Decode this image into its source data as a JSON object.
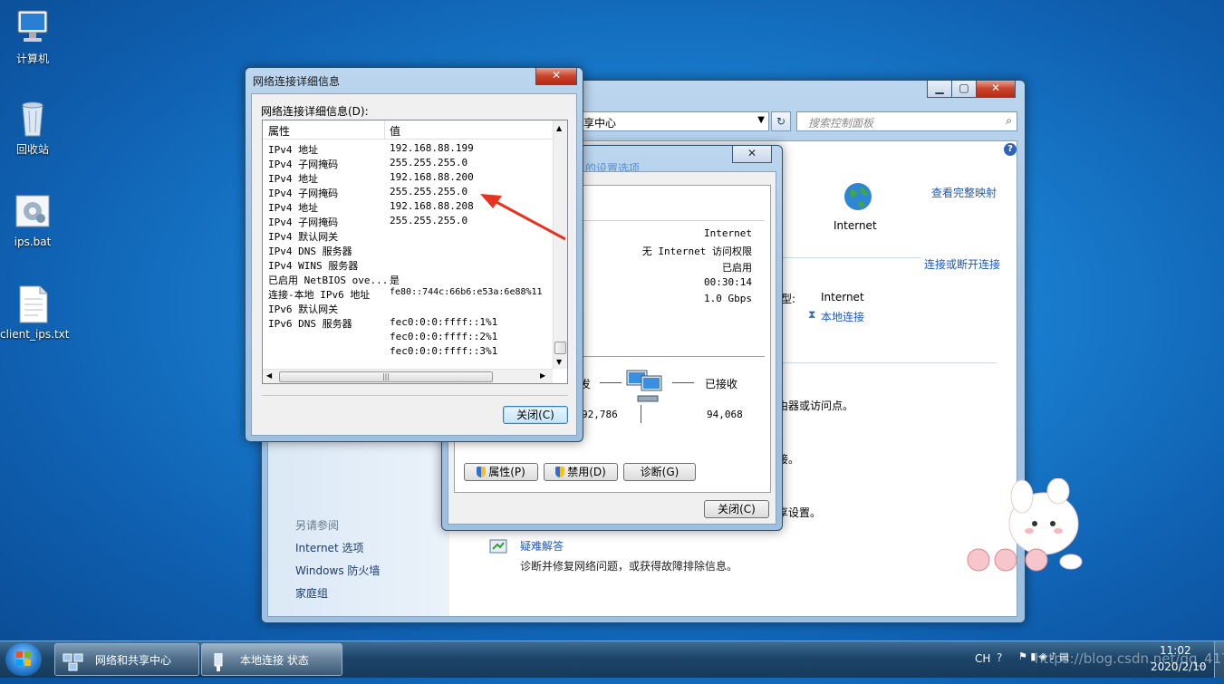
{
  "desktop": {
    "icons": [
      {
        "label": "计算机",
        "icon": "computer-icon"
      },
      {
        "label": "回收站",
        "icon": "recycle-bin-icon"
      },
      {
        "label": "ips.bat",
        "icon": "batch-file-icon"
      },
      {
        "label": "client_ips.txt",
        "icon": "text-file-icon"
      }
    ]
  },
  "control_panel": {
    "breadcrumb": "享中心",
    "search_placeholder": "搜索控制面板",
    "view_full_map": "查看完整映射",
    "internet_label": "Internet",
    "connect_disconnect": "连接或断开连接",
    "type_label": "型:",
    "type_value": "Internet",
    "local_connection": "本地连接",
    "router_text": "由器或访问点。",
    "task_text_1": "接。",
    "share_text": "享设置。",
    "see_also": "另请参阅",
    "sidebar_links": [
      "Internet 选项",
      "Windows 防火墙",
      "家庭组"
    ],
    "troubleshoot_title": "疑难解答",
    "troubleshoot_desc": "诊断并修复网络问题，或获得故障排除信息。"
  },
  "status_dialog": {
    "link_partial": "的设置选项",
    "ipv4_connectivity": "Internet",
    "ipv6_connectivity": "无 Internet 访问权限",
    "media_state": "已启用",
    "duration": "00:30:14",
    "speed": "1.0 Gbps",
    "sent_label": "发",
    "received_label": "已接收",
    "bytes_sent": "92,786",
    "bytes_received": "94,068",
    "properties_button": "属性(P)",
    "disable_button": "禁用(D)",
    "diagnose_button": "诊断(G)",
    "close_button": "关闭(C)"
  },
  "details_dialog": {
    "title": "网络连接详细信息",
    "group_label": "网络连接详细信息(D):",
    "col_property": "属性",
    "col_value": "值",
    "rows": [
      {
        "property": "IPv4 地址",
        "value": "192.168.88.199"
      },
      {
        "property": "IPv4 子网掩码",
        "value": "255.255.255.0"
      },
      {
        "property": "IPv4 地址",
        "value": "192.168.88.200"
      },
      {
        "property": "IPv4 子网掩码",
        "value": "255.255.255.0"
      },
      {
        "property": "IPv4 地址",
        "value": "192.168.88.208"
      },
      {
        "property": "IPv4 子网掩码",
        "value": "255.255.255.0"
      },
      {
        "property": "IPv4 默认网关",
        "value": ""
      },
      {
        "property": "IPv4 DNS 服务器",
        "value": ""
      },
      {
        "property": "IPv4 WINS 服务器",
        "value": ""
      },
      {
        "property": "已启用 NetBIOS ove...",
        "value": "是"
      },
      {
        "property": "连接-本地 IPv6 地址",
        "value": "fe80::744c:66b6:e53a:6e88%11"
      },
      {
        "property": "IPv6 默认网关",
        "value": ""
      },
      {
        "property": "IPv6 DNS 服务器",
        "value": "fec0:0:0:ffff::1%1"
      },
      {
        "property": "",
        "value": "fec0:0:0:ffff::2%1"
      },
      {
        "property": "",
        "value": "fec0:0:0:ffff::3%1"
      }
    ],
    "close_button": "关闭(C)"
  },
  "taskbar": {
    "items": [
      "网络和共享中心",
      "本地连接 状态"
    ],
    "language": "CH",
    "time": "11:02",
    "date": "2020/2/10"
  },
  "watermark": "https://blog.csdn.net/qq_41782425"
}
